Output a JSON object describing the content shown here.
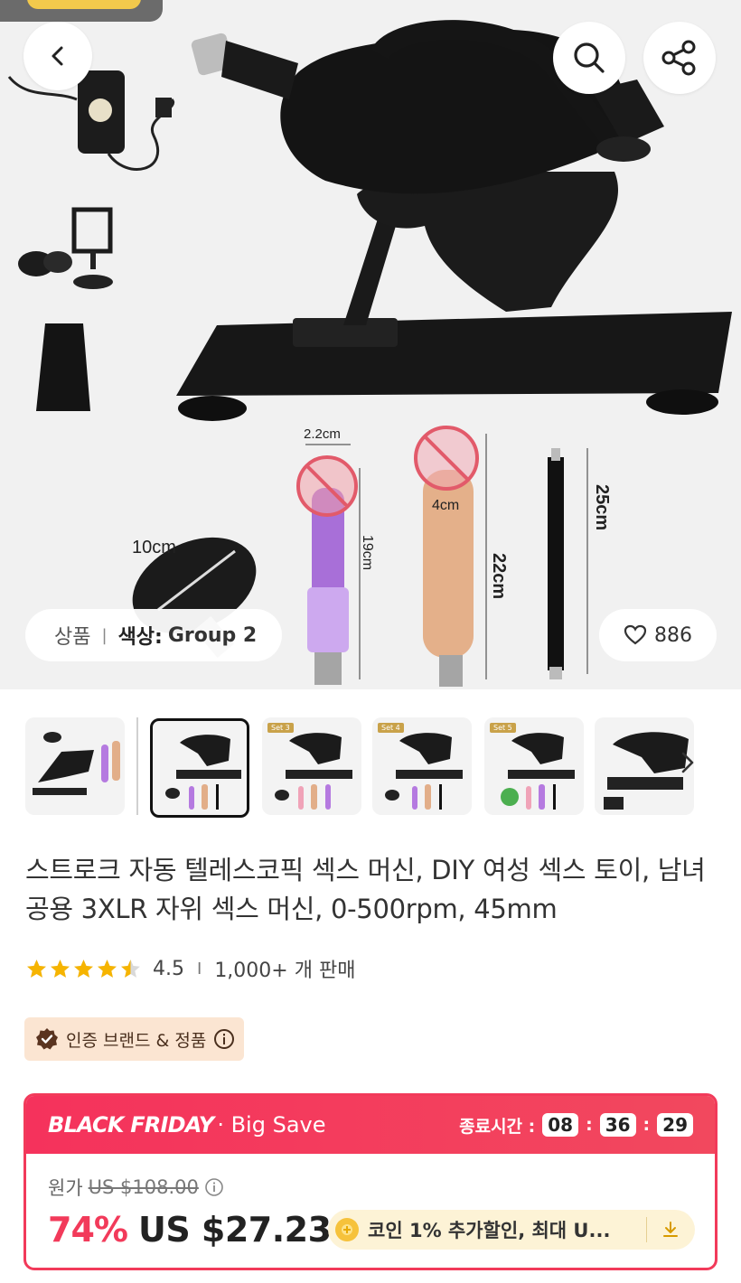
{
  "hero": {
    "measurements": {
      "base_width": "10cm",
      "dildo1_width": "2.2cm",
      "dildo1_length": "19cm",
      "dildo2_width": "4cm",
      "dildo2_length": "22cm",
      "rod_length": "25cm"
    },
    "category_label": "상품",
    "separator": "|",
    "variant_label": "색상:",
    "variant_value": "Group 2",
    "like_count": "886"
  },
  "thumbnails": [
    {
      "tag": ""
    },
    {
      "tag": ""
    },
    {
      "tag": "Set 3"
    },
    {
      "tag": "Set 4"
    },
    {
      "tag": "Set 5"
    },
    {
      "tag": ""
    }
  ],
  "product": {
    "title": "스트로크 자동 텔레스코픽 섹스 머신, DIY 여성 섹스 토이, 남녀공용 3XLR 자위 섹스 머신, 0-500rpm, 45mm",
    "rating_value": "4.5",
    "rating_stars": 4.5,
    "rating_separator": "I",
    "sold": "1,000+ 개 판매",
    "badge": "인증 브랜드 & 정품"
  },
  "promo": {
    "brand": "BLACK FRIDAY",
    "sub": "· Big Save",
    "timer_label": "종료시간 :",
    "hours": "08",
    "minutes": "36",
    "seconds": "29",
    "colon": ":",
    "original_label": "원가",
    "original_price": "US $108.00",
    "discount": "74%",
    "price": "US $27.23",
    "coin_text": "코인 1% 추가할인, 최대 U..."
  },
  "colors": {
    "accent": "#f23a5a",
    "badge_bg": "#fbe5d2",
    "star": "#f6b400",
    "coin_bg": "#fdf3d6"
  },
  "icons": [
    "back-chevron-icon",
    "search-icon",
    "share-icon",
    "heart-icon",
    "chevron-right-icon",
    "verified-check-icon",
    "info-icon",
    "coin-icon",
    "download-icon",
    "star-icon"
  ]
}
